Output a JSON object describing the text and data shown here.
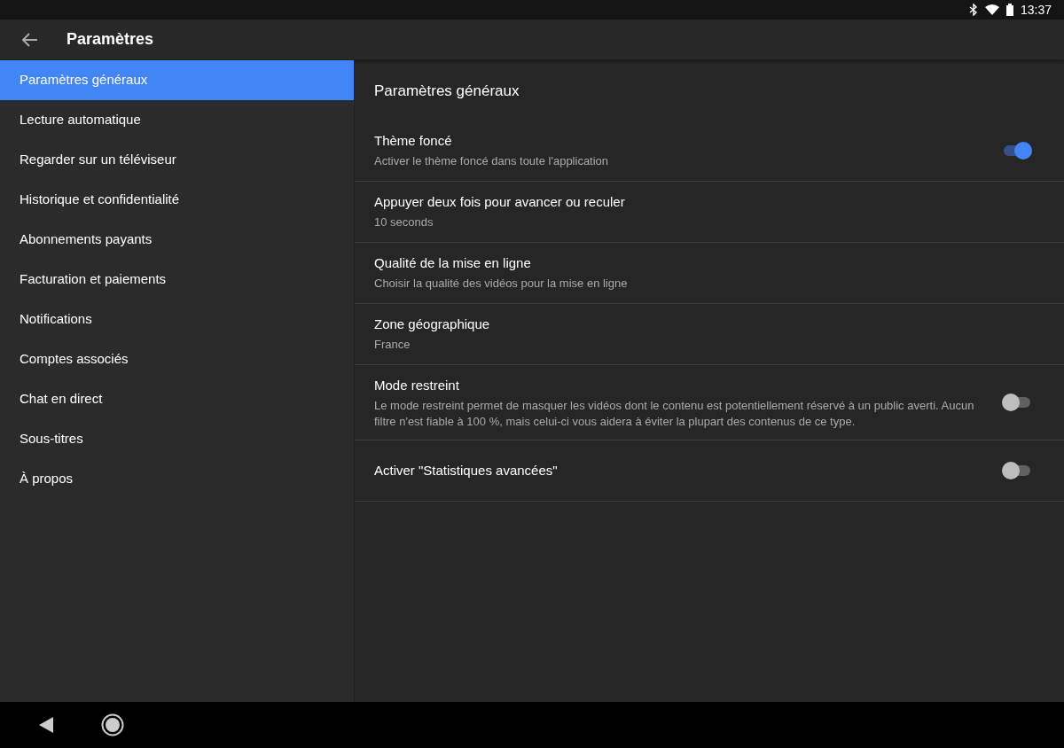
{
  "status_bar": {
    "time": "13:37"
  },
  "header": {
    "title": "Paramètres"
  },
  "sidebar": {
    "items": [
      {
        "label": "Paramètres généraux",
        "selected": true
      },
      {
        "label": "Lecture automatique",
        "selected": false
      },
      {
        "label": "Regarder sur un téléviseur",
        "selected": false
      },
      {
        "label": "Historique et confidentialité",
        "selected": false
      },
      {
        "label": "Abonnements payants",
        "selected": false
      },
      {
        "label": "Facturation et paiements",
        "selected": false
      },
      {
        "label": "Notifications",
        "selected": false
      },
      {
        "label": "Comptes associés",
        "selected": false
      },
      {
        "label": "Chat en direct",
        "selected": false
      },
      {
        "label": "Sous-titres",
        "selected": false
      },
      {
        "label": "À propos",
        "selected": false
      }
    ]
  },
  "content": {
    "title": "Paramètres généraux",
    "settings": [
      {
        "kind": "toggle",
        "title": "Thème foncé",
        "subtitle": "Activer le thème foncé dans toute l'application",
        "on": true
      },
      {
        "kind": "plain",
        "title": "Appuyer deux fois pour avancer ou reculer",
        "subtitle": "10 seconds"
      },
      {
        "kind": "plain",
        "title": "Qualité de la mise en ligne",
        "subtitle": "Choisir la qualité des vidéos pour la mise en ligne"
      },
      {
        "kind": "plain",
        "title": "Zone géographique",
        "subtitle": "France"
      },
      {
        "kind": "toggle",
        "title": "Mode restreint",
        "subtitle": "Le mode restreint permet de masquer les vidéos dont le contenu est potentiellement réservé à un public averti. Aucun filtre n'est fiable à 100 %, mais celui-ci vous aidera à éviter la plupart des contenus de ce type.",
        "on": false
      },
      {
        "kind": "toggle",
        "title": "Activer \"Statistiques avancées\"",
        "on": false
      }
    ]
  }
}
